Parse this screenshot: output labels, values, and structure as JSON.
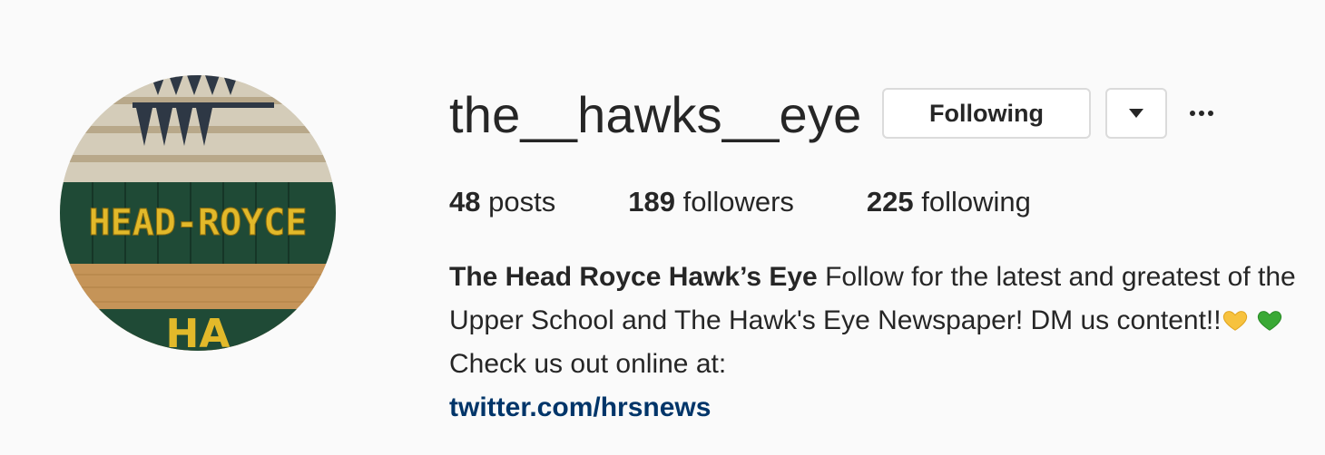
{
  "profile": {
    "username": "the__hawks__eye",
    "following_button_label": "Following",
    "stats": [
      {
        "count": "48",
        "label": "posts"
      },
      {
        "count": "189",
        "label": "followers"
      },
      {
        "count": "225",
        "label": "following"
      }
    ],
    "bio": {
      "full_name": "The Head Royce Hawk’s Eye",
      "text_1": " Follow for the latest and greatest of the Upper School and The Hawk's Eye Newspaper! DM us content!!",
      "text_2": "  Check us out online at:",
      "link": "twitter.com/hrsnews"
    },
    "avatar": {
      "banner_text": "HEAD-ROYCE",
      "floor_text": "HA"
    }
  },
  "icons": {
    "dropdown": "chevron-down-icon",
    "more": "more-options-icon",
    "heart_yellow": "yellow-heart-icon",
    "heart_green": "green-heart-icon"
  },
  "colors": {
    "background": "#fafafa",
    "text": "#262626",
    "link": "#003569",
    "border": "#dbdbdb",
    "heart_yellow": "#f7c23e",
    "heart_green": "#3aa935",
    "banner_green": "#1f4a36",
    "banner_yellow": "#e2b92a"
  }
}
